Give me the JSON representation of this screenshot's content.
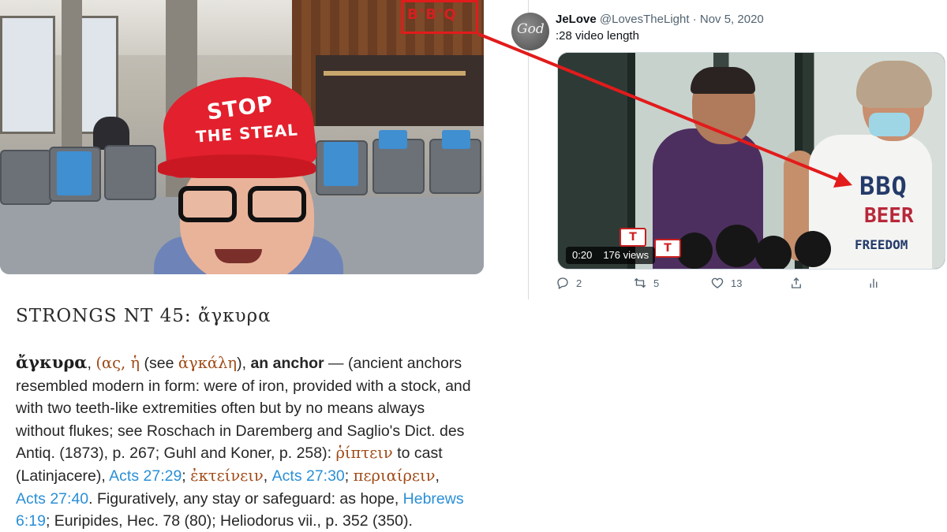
{
  "video_still": {
    "sign_text": "B'B'Q",
    "cap_line1": "STOP",
    "cap_line2": "THE STEAL"
  },
  "definition": {
    "title": "STRONGS NT 45: ἄγκυρα",
    "headword": "ἄγκυρα",
    "segments": [
      "(ας, ἡ",
      " (see ",
      "ἀγκάλη",
      "), ",
      "an anchor",
      " — (ancient anchors resembled modern in form: were of iron, provided with a stock, and with two teeth-like extremities often but by no means always without flukes; see Roschach in Daremberg and Saglio's Dict. des Antiq. (1873), p. 267; Guhl and Koner, p. 258): ",
      "ῥίπτειν",
      " to cast (Latinjacere), ",
      "Acts 27:29",
      "; ",
      "ἐκτείνειν",
      ", ",
      "Acts 27:30",
      "; ",
      "περιαίρειν",
      ", ",
      "Acts 27:40",
      ". Figuratively, any stay or safeguard: as hope, ",
      "Hebrews 6:19",
      "; Euripides, Hec. 78 (80); Heliodorus vii., p. 352 (350)."
    ]
  },
  "tweet": {
    "avatar_text": "God",
    "name": "JeLove",
    "handle": "@LovesTheLight",
    "separator": "·",
    "date": "Nov 5, 2020",
    "text": ":28 video length",
    "media": {
      "duration": "0:20",
      "views": "176 views",
      "shirt_line1": "BBQ",
      "shirt_line2": "BEER",
      "shirt_line3": "FREEDOM",
      "mic_flag": "T"
    },
    "actions": {
      "reply_count": "2",
      "retweet_count": "5",
      "like_count": "13"
    }
  },
  "colors": {
    "annotation_red": "#e21b1b",
    "greek_brown": "#a04a17",
    "link_blue": "#2a8fd6",
    "cap_red": "#e3202d"
  },
  "icons": [
    "reply-icon",
    "retweet-icon",
    "like-icon",
    "share-icon",
    "analytics-icon"
  ]
}
